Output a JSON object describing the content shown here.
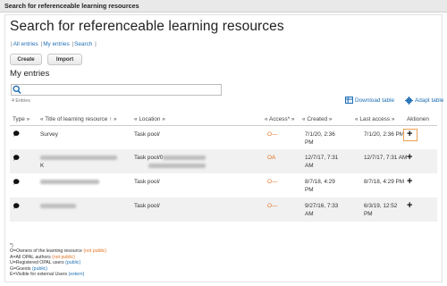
{
  "window_title": "Search for referenceable learning resources",
  "page_title": "Search for referenceable learning resources",
  "nav": {
    "all_entries": "All entries",
    "my_entries": "My entries",
    "search": "Search"
  },
  "buttons": {
    "create": "Create",
    "import": "Import"
  },
  "section_title": "My entries",
  "search": {
    "placeholder": "",
    "value": ""
  },
  "entries_count": "4 Entries",
  "toolbar": {
    "download": "Download table",
    "adapt": "Adapt table"
  },
  "table": {
    "headers": {
      "type": "Type »",
      "title": "« Title of learning resource ↑ »",
      "location": "« Location »",
      "access": "« Access* »",
      "created": "« Created »",
      "last_access": "« Last access »",
      "actions": "Aktionen"
    },
    "rows": [
      {
        "title": "Survey",
        "location": "Task pool/",
        "access": "O—",
        "created_1": "7/1/20, 2:36",
        "created_2": "PM",
        "last_access": "7/1/20, 2:36 PM",
        "action": "+"
      },
      {
        "title": "",
        "title_2": "K",
        "location": "Task pool/0",
        "access": "OA",
        "created_1": "12/7/17, 7:31",
        "created_2": "AM",
        "last_access": "12/7/17, 7:31 AM",
        "action": "+"
      },
      {
        "title": "",
        "location": "Task pool/",
        "access": "O—",
        "created_1": "8/7/18, 4:29",
        "created_2": "PM",
        "last_access": "8/7/18, 4:29 PM",
        "action": "+"
      },
      {
        "title": "",
        "location": "Task pool/",
        "access": "O—",
        "created_1": "9/27/16, 7:33",
        "created_2": "AM",
        "last_access": "6/3/19, 12:52",
        "last_access_2": "PM",
        "action": "+"
      }
    ]
  },
  "legend": {
    "star": "*)",
    "l1": "O=Owners of the learning resource",
    "l1_tag": "(not public)",
    "l2": "A=All OPAL authors",
    "l2_tag": "(not public)",
    "l3": "U=Registered OPAL users",
    "l3_tag": "(public)",
    "l4": "G=Guests",
    "l4_tag": "(public)",
    "l5": "E=Visible for external Users",
    "l5_tag": "(extern)"
  }
}
